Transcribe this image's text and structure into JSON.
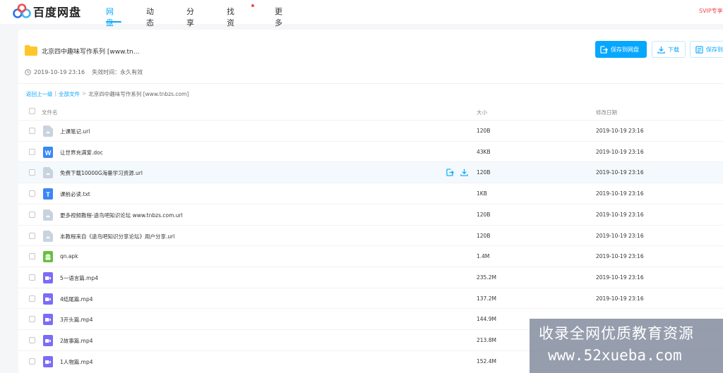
{
  "app": {
    "logo_text": "百度网盘"
  },
  "nav": {
    "items": [
      {
        "label": "网盘",
        "active": true
      },
      {
        "label": "动态",
        "active": false
      },
      {
        "label": "分享",
        "active": false
      },
      {
        "label": "找资源",
        "active": false,
        "badge_dot": true
      },
      {
        "label": "更多",
        "active": false
      }
    ],
    "svip_text": "SVIP专享"
  },
  "share": {
    "title": "北京四中趣味写作系列  [www.tn...",
    "date": "2019-10-19 23:16",
    "expire": "失效时间：永久有效",
    "buttons": {
      "save": "保存到网盘",
      "download": "下载",
      "save2": "保存到"
    }
  },
  "breadcrumb": {
    "back": "返回上一级",
    "all": "全部文件",
    "sep": ">",
    "current": "北京四中趣味写作系列 [www.tnbzs.com]",
    "divider": "|"
  },
  "table": {
    "headers": {
      "name": "文件名",
      "size": "大小",
      "date": "修改日期"
    },
    "rows": [
      {
        "name": "上课笔记.url",
        "size": "120B",
        "date": "2019-10-19 23:16",
        "icon": "url-file-icon"
      },
      {
        "name": "让世界充满爱.doc",
        "size": "43KB",
        "date": "2019-10-19 23:16",
        "icon": "word-file-icon"
      },
      {
        "name": "免费下载10000G海量学习资源.url",
        "size": "120B",
        "date": "2019-10-19 23:16",
        "icon": "url-file-icon",
        "hover": true
      },
      {
        "name": "课前必读.txt",
        "size": "1KB",
        "date": "2019-10-19 23:16",
        "icon": "text-file-icon"
      },
      {
        "name": "更多视频教程-途鸟吧知识论坛 www.tnbzs.com.url",
        "size": "120B",
        "date": "2019-10-19 23:16",
        "icon": "url-file-icon"
      },
      {
        "name": "本教程来自《途鸟吧知识分享论坛》用户分享.url",
        "size": "120B",
        "date": "2019-10-19 23:16",
        "icon": "url-file-icon"
      },
      {
        "name": "qn.apk",
        "size": "1.4M",
        "date": "2019-10-19 23:16",
        "icon": "apk-file-icon"
      },
      {
        "name": "5一语言篇.mp4",
        "size": "235.2M",
        "date": "2019-10-19 23:16",
        "icon": "video-file-icon"
      },
      {
        "name": "4结尾篇.mp4",
        "size": "137.2M",
        "date": "2019-10-19 23:16",
        "icon": "video-file-icon"
      },
      {
        "name": "3开头篇.mp4",
        "size": "144.9M",
        "date": "",
        "icon": "video-file-icon"
      },
      {
        "name": "2故事篇.mp4",
        "size": "213.8M",
        "date": "",
        "icon": "video-file-icon"
      },
      {
        "name": "1人物篇.mp4",
        "size": "152.4M",
        "date": "",
        "icon": "video-file-icon"
      }
    ]
  },
  "watermark": {
    "line1": "收录全网优质教育资源",
    "line2": "www.52xueba.com"
  },
  "colors": {
    "accent": "#06a7ff",
    "svip": "#f2484b",
    "folder": "#ffc629",
    "word": "#3d87f5",
    "video": "#7b6cf6",
    "apk": "#67c23a",
    "url": "#c9d3de"
  }
}
